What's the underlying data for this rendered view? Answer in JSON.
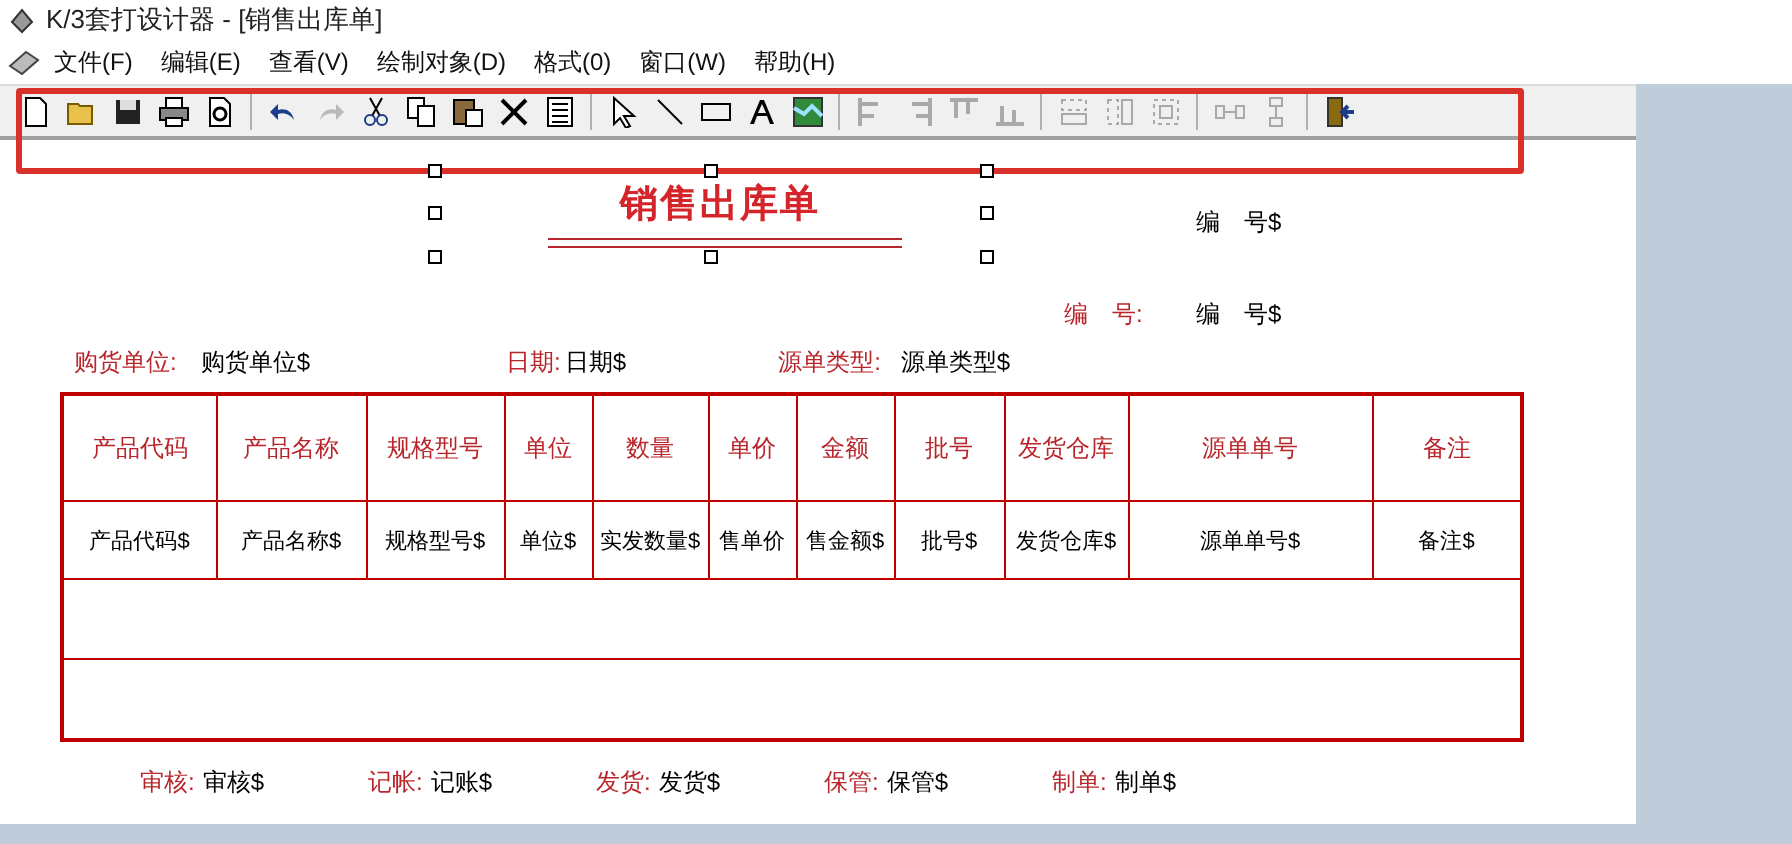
{
  "window": {
    "title": "K/3套打设计器 - [销售出库单]"
  },
  "menu": [
    "文件(F)",
    "编辑(E)",
    "查看(V)",
    "绘制对象(D)",
    "格式(0)",
    "窗口(W)",
    "帮助(H)"
  ],
  "toolbar": {
    "highlighted": true,
    "groups": [
      [
        {
          "kind": "new",
          "disabled": false
        },
        {
          "kind": "open",
          "disabled": false
        },
        {
          "kind": "save",
          "disabled": false
        },
        {
          "kind": "print",
          "disabled": false
        },
        {
          "kind": "preview",
          "disabled": false
        }
      ],
      [
        {
          "kind": "undo",
          "disabled": false
        },
        {
          "kind": "redo",
          "disabled": true
        },
        {
          "kind": "cut",
          "disabled": false
        },
        {
          "kind": "copy",
          "disabled": false
        },
        {
          "kind": "paste",
          "disabled": false
        },
        {
          "kind": "delete",
          "disabled": false
        },
        {
          "kind": "properties",
          "disabled": false
        }
      ],
      [
        {
          "kind": "pointer",
          "disabled": false
        },
        {
          "kind": "line",
          "disabled": false
        },
        {
          "kind": "rectangle",
          "disabled": false
        },
        {
          "kind": "text",
          "disabled": false
        },
        {
          "kind": "image",
          "disabled": false
        }
      ],
      [
        {
          "kind": "align-left",
          "disabled": true
        },
        {
          "kind": "align-right",
          "disabled": true
        },
        {
          "kind": "align-top",
          "disabled": true
        },
        {
          "kind": "align-bottom",
          "disabled": true
        }
      ],
      [
        {
          "kind": "same-width",
          "disabled": true
        },
        {
          "kind": "same-height",
          "disabled": true
        },
        {
          "kind": "same-size",
          "disabled": true
        }
      ],
      [
        {
          "kind": "space-horizontal",
          "disabled": true
        },
        {
          "kind": "space-vertical",
          "disabled": true
        }
      ],
      [
        {
          "kind": "exit",
          "disabled": false
        }
      ]
    ]
  },
  "report": {
    "title": "销售出库单",
    "title_selected": true,
    "top_field": "编　号$",
    "number": {
      "label": "编　号:",
      "value": "编　号$"
    },
    "fields": [
      {
        "label": "购货单位:",
        "value": "购货单位$"
      },
      {
        "label": "日期:",
        "value": "日期$"
      },
      {
        "label": "源单类型:",
        "value": "源单类型$"
      }
    ],
    "table": {
      "highlighted": true,
      "columns": [
        "产品代码",
        "产品名称",
        "规格型号",
        "单位",
        "数量",
        "单价",
        "金额",
        "批号",
        "发货仓库",
        "源单单号",
        "备注"
      ],
      "row": [
        "产品代码$",
        "产品名称$",
        "规格型号$",
        "单位$",
        "实发数量$",
        "售单价",
        "售金额$",
        "批号$",
        "发货仓库$",
        "源单单号$",
        "备注$"
      ]
    },
    "footer": [
      {
        "label": "审核:",
        "value": "审核$"
      },
      {
        "label": "记帐:",
        "value": "记账$"
      },
      {
        "label": "发货:",
        "value": "发货$"
      },
      {
        "label": "保管:",
        "value": "保管$"
      },
      {
        "label": "制单:",
        "value": "制单$"
      }
    ]
  }
}
